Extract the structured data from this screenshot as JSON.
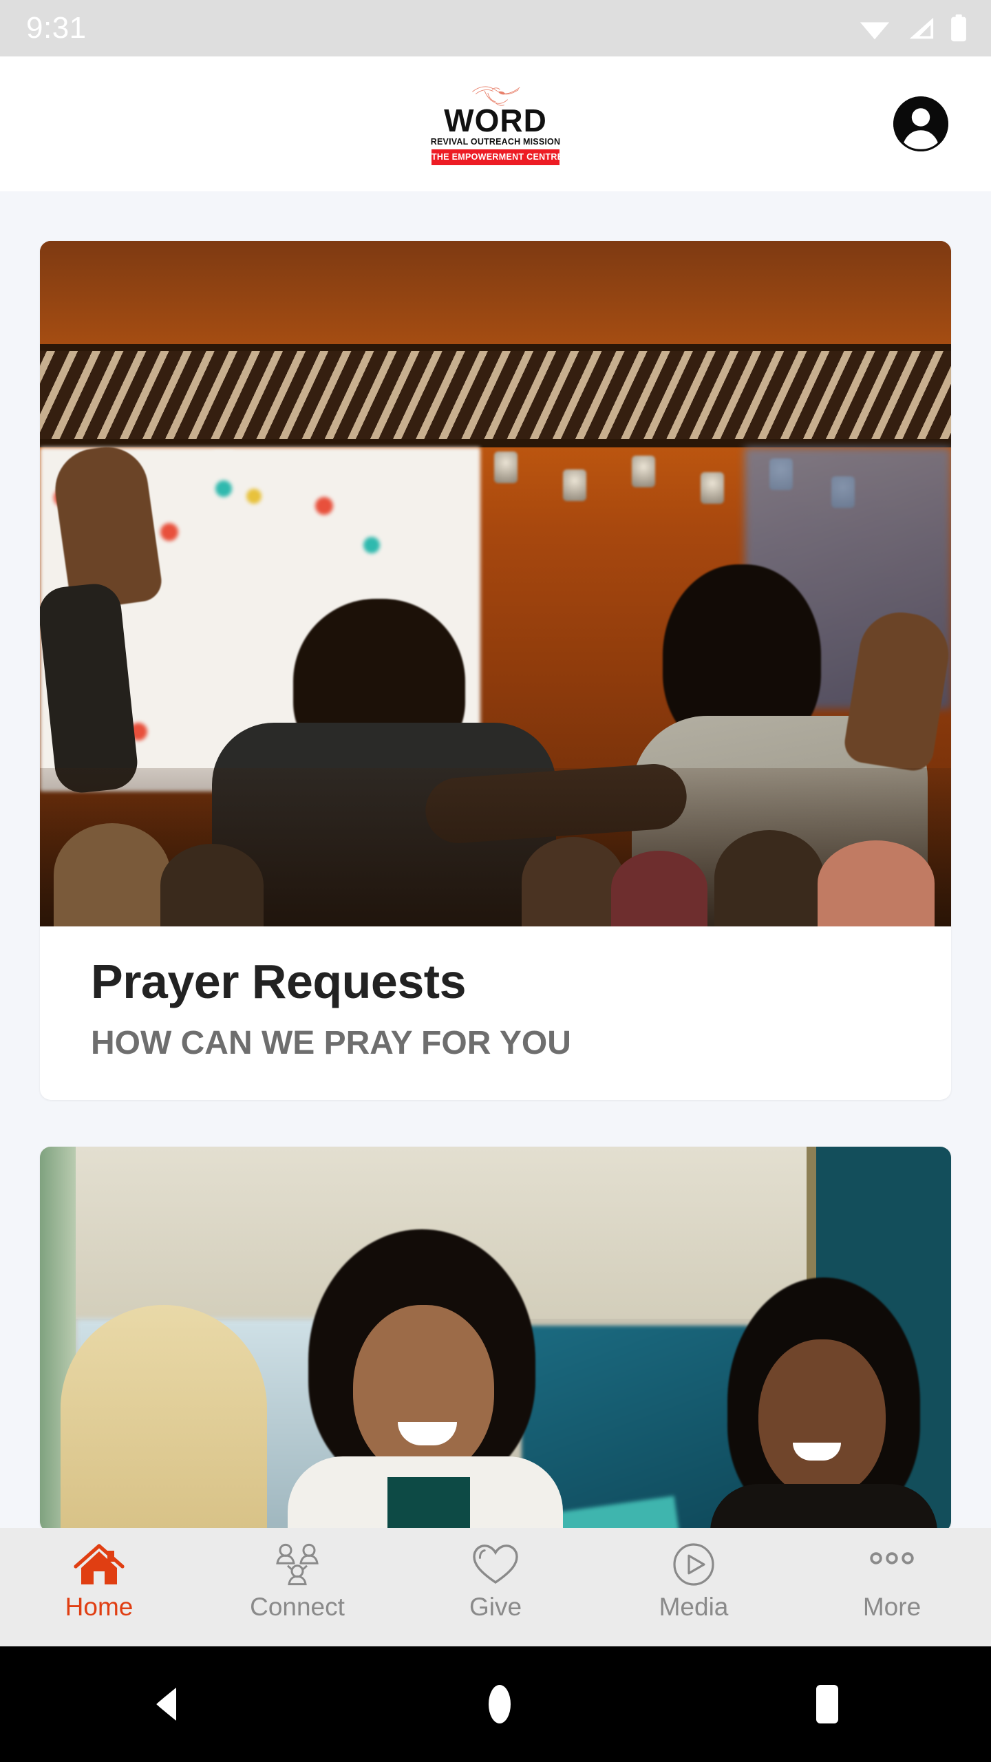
{
  "status_bar": {
    "time": "9:31",
    "icons": [
      "wifi-icon",
      "cellular-signal-icon",
      "battery-icon"
    ],
    "background_color": "#DEDEDE",
    "foreground_color": "#FFFFFF"
  },
  "header": {
    "logo": {
      "icon": "dove-icon",
      "wordmark": "WORD",
      "tagline": "REVIVAL OUTREACH MISSION",
      "banner": "THE EMPOWERMENT CENTRE",
      "bird_color": "#E8806B",
      "banner_color": "#ED1C24"
    },
    "account_button": "account-avatar-icon"
  },
  "main": {
    "cards": [
      {
        "image_alt": "people-praying-photo",
        "title": "Prayer Requests",
        "subtitle": "HOW CAN WE PRAY FOR YOU"
      },
      {
        "image_alt": "smiling-women-group-photo",
        "title": "",
        "subtitle": ""
      }
    ]
  },
  "bottom_nav": {
    "active_color": "#E03E12",
    "inactive_color": "#8A8A8A",
    "background_color": "#EBEBEB",
    "items": [
      {
        "label": "Home",
        "icon": "home-icon",
        "active": true
      },
      {
        "label": "Connect",
        "icon": "people-group-icon",
        "active": false
      },
      {
        "label": "Give",
        "icon": "heart-icon",
        "active": false
      },
      {
        "label": "Media",
        "icon": "play-circle-icon",
        "active": false
      },
      {
        "label": "More",
        "icon": "more-dots-icon",
        "active": false
      }
    ]
  },
  "android_nav": {
    "back": "back-triangle-icon",
    "home": "home-circle-icon",
    "recents": "recents-square-icon"
  }
}
